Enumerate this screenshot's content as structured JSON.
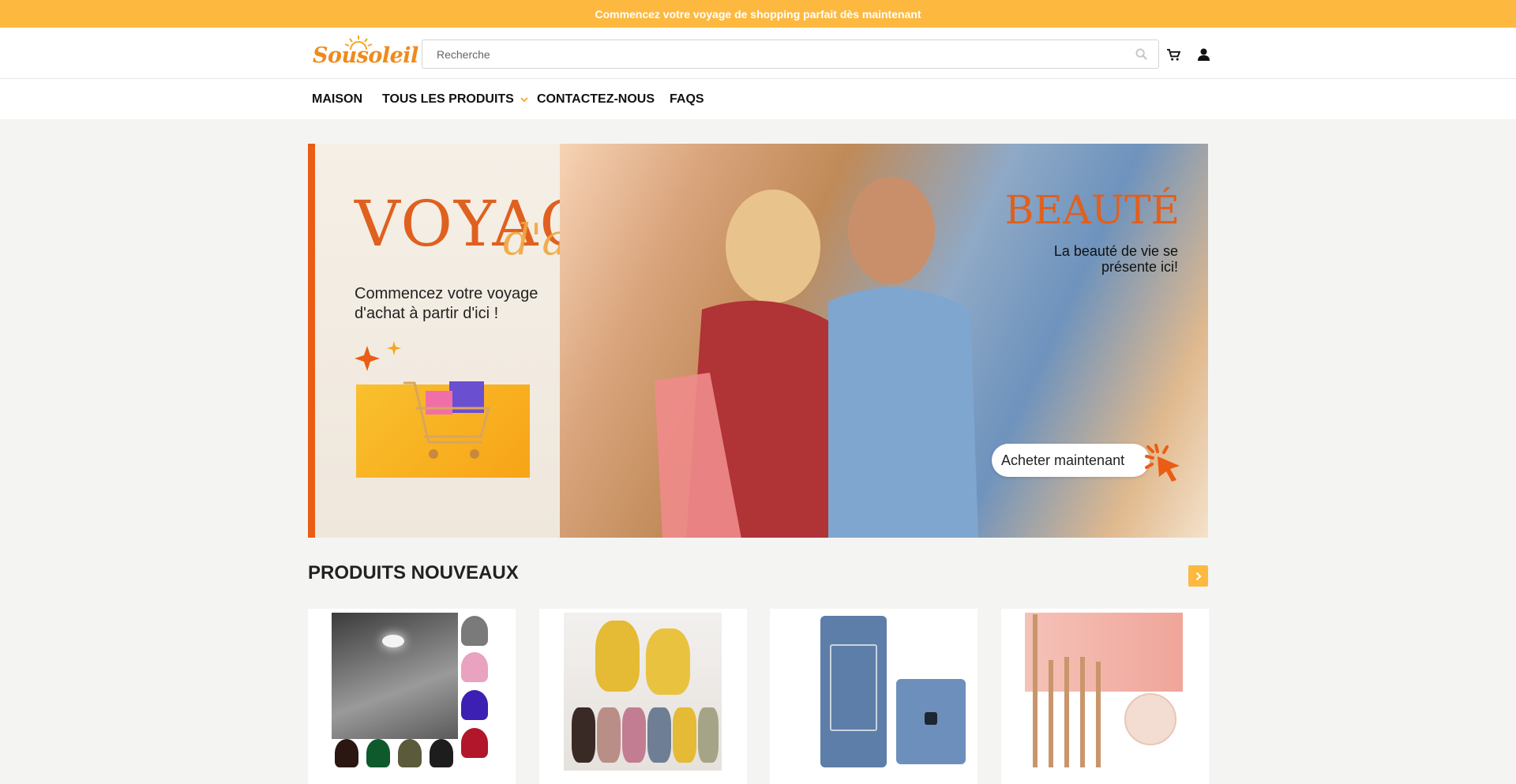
{
  "announcement": "Commencez votre voyage de shopping parfait dès maintenant",
  "logo": {
    "text": "Sousoleil"
  },
  "search": {
    "placeholder": "Recherche"
  },
  "nav": [
    {
      "label": "MAISON"
    },
    {
      "label": "TOUS LES PRODUITS"
    },
    {
      "label": "CONTACTEZ-NOUS"
    },
    {
      "label": "FAQS"
    }
  ],
  "hero": {
    "title": "VOYAGE",
    "title_script": "d'achat",
    "subtitle": "Commencez votre voyage d'achat à partir d'ici !",
    "right_title": "BEAUTÉ",
    "right_subtitle": "La beauté de vie se présente ici!",
    "cta": "Acheter maintenant"
  },
  "section": {
    "title": "PRODUITS NOUVEAUX"
  },
  "colors": {
    "accent": "#fdb93f",
    "brand_orange": "#e0601f"
  }
}
